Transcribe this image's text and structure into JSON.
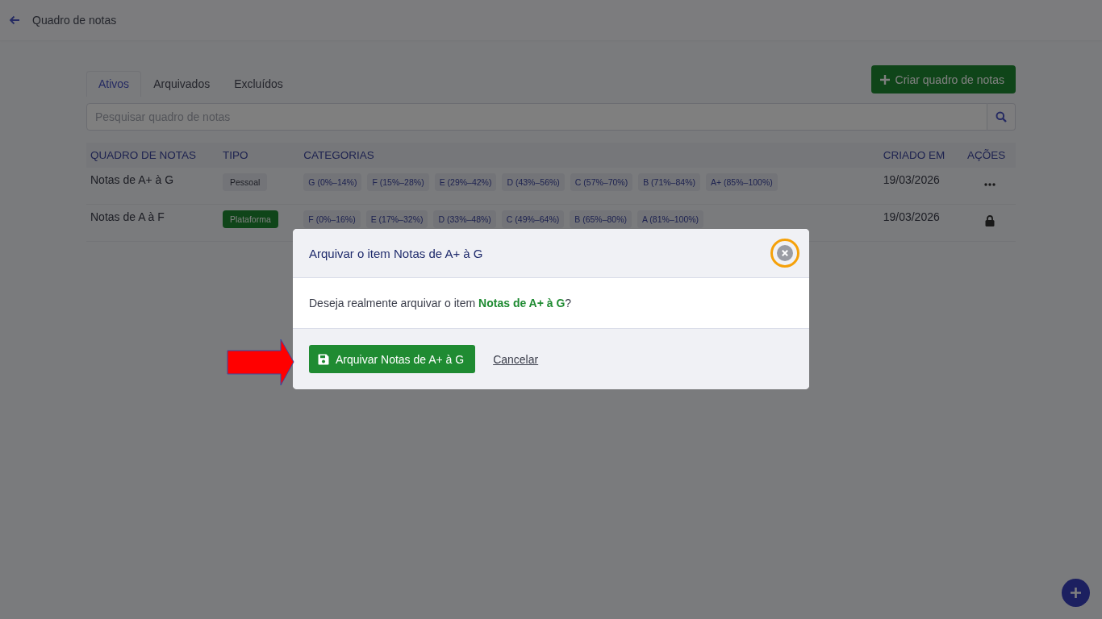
{
  "header": {
    "title": "Quadro de notas"
  },
  "tabs": [
    {
      "label": "Ativos",
      "selected": true
    },
    {
      "label": "Arquivados",
      "selected": false
    },
    {
      "label": "Excluídos",
      "selected": false
    }
  ],
  "create_button": "Criar quadro de notas",
  "search": {
    "placeholder": "Pesquisar quadro de notas"
  },
  "table": {
    "columns": [
      "QUADRO DE NOTAS",
      "TIPO",
      "CATEGORIAS",
      "CRIADO EM",
      "AÇÕES"
    ],
    "rows": [
      {
        "name": "Notas de A+ à G",
        "type": {
          "label": "Pessoal",
          "kind": "personal"
        },
        "categories": [
          "G (0%–14%)",
          "F (15%–28%)",
          "E (29%–42%)",
          "D (43%–56%)",
          "C (57%–70%)",
          "B (71%–84%)",
          "A+ (85%–100%)"
        ],
        "created": "19/03/2026",
        "kind": "menu"
      },
      {
        "name": "Notas de A à F",
        "type": {
          "label": "Plataforma",
          "kind": "platform"
        },
        "categories": [
          "F (0%–16%)",
          "E (17%–32%)",
          "D (33%–48%)",
          "C (49%–64%)",
          "B (65%–80%)",
          "A (81%–100%)"
        ],
        "created": "19/03/2026",
        "kind": "locked"
      }
    ]
  },
  "dialog": {
    "title": "Arquivar o item Notas de A+ à G",
    "message": "Deseja realmente arquivar o item **Notas de A+ à G**?",
    "confirm": "Arquivar Notas de A+ à G",
    "cancel": "Cancelar",
    "close_highlighted": true,
    "pointer_arrow": true
  }
}
